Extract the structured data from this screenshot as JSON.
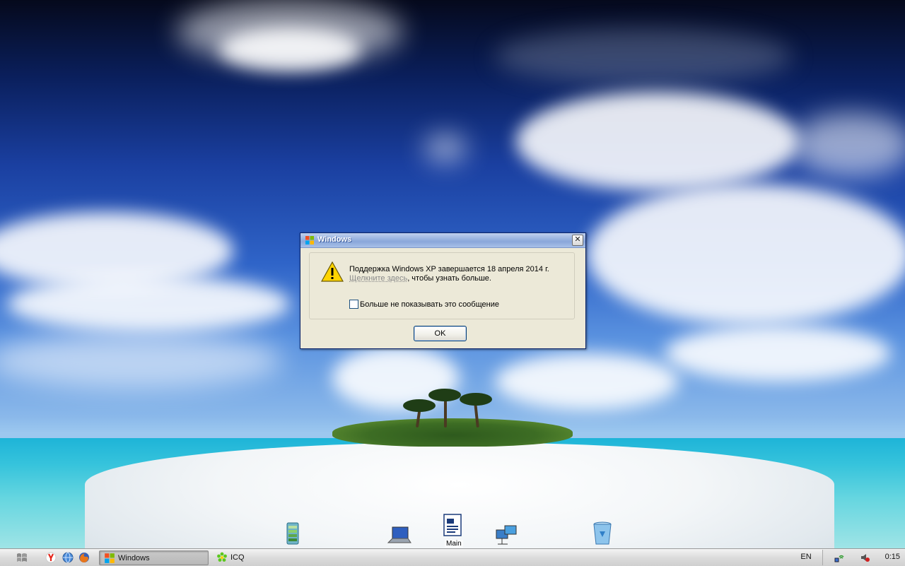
{
  "dialog": {
    "title": "Windows",
    "message_line1": "Поддержка Windows XP завершается 18 апреля 2014 г.",
    "message_link": "Щелкните здесь",
    "message_line2_rest": ", чтобы узнать больше.",
    "checkbox_label": "Больше не показывать это сообщение",
    "checkbox_checked": false,
    "ok_label": "OK",
    "close_symbol": "✕"
  },
  "desktop": {
    "icons": [
      {
        "name": "winrar-icon",
        "label": ""
      },
      {
        "name": "laptop-icon",
        "label": ""
      },
      {
        "name": "document-icon",
        "label": "Main"
      },
      {
        "name": "network-icon",
        "label": ""
      },
      {
        "name": "recycle-bin-icon",
        "label": ""
      }
    ]
  },
  "taskbar": {
    "quick_launch": [
      "yandex-browser-icon",
      "globe-icon",
      "firefox-icon"
    ],
    "tasks": [
      {
        "label": "Windows",
        "icon": "windows-flag-icon",
        "active": true
      },
      {
        "label": "ICQ",
        "icon": "icq-flower-icon",
        "active": false
      }
    ],
    "language": "EN",
    "tray_icons": [
      "wifi-icon",
      "speaker-icon"
    ],
    "clock": "0:15"
  },
  "colors": {
    "dialog_bg": "#ece9d8",
    "titlebar": "#9ab4e0",
    "taskbar": "#d8d8d8"
  }
}
